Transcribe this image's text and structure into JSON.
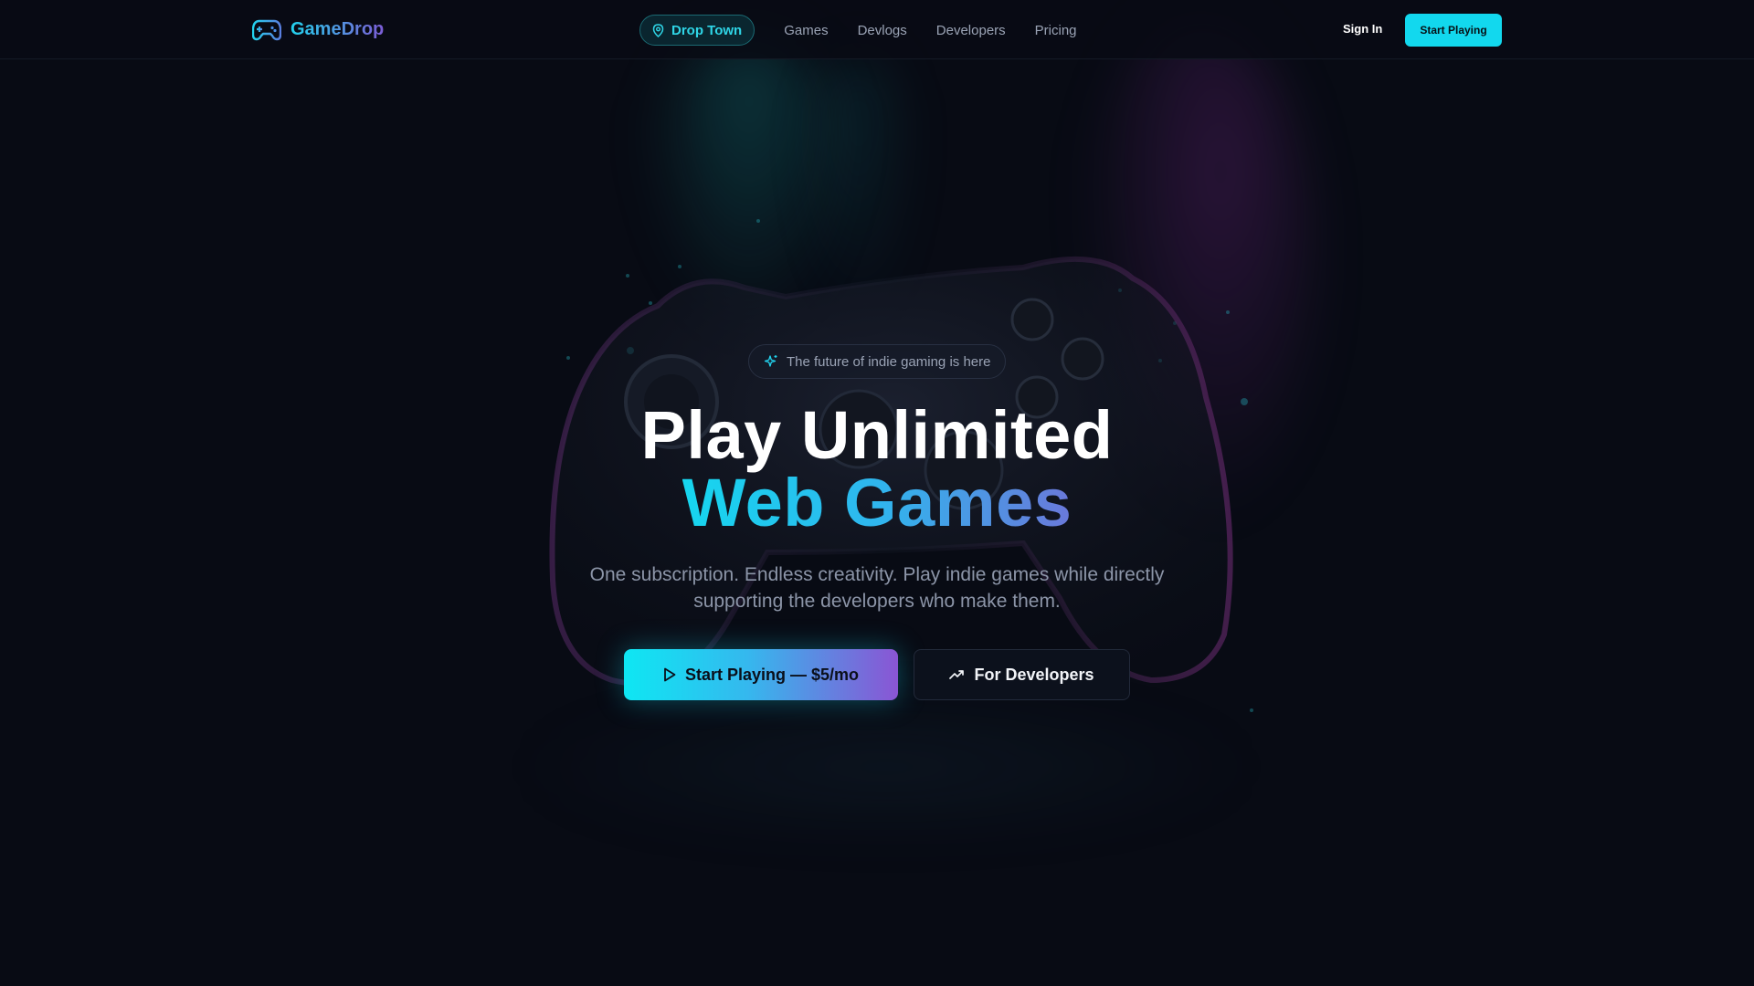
{
  "brand": {
    "name": "GameDrop",
    "icon": "gamepad-icon"
  },
  "nav": {
    "pill_label": "Drop Town",
    "pill_icon": "map-pin-icon",
    "links": [
      {
        "label": "Games"
      },
      {
        "label": "Devlogs"
      },
      {
        "label": "Developers"
      },
      {
        "label": "Pricing"
      }
    ],
    "sign_in": "Sign In",
    "cta": "Start Playing"
  },
  "hero": {
    "tagline": "The future of indie gaming is here",
    "tagline_icon": "sparkles-icon",
    "headline_line1": "Play Unlimited",
    "headline_line2": "Web Games",
    "subtitle": "One subscription. Endless creativity. Play indie games while directly supporting the developers who make them.",
    "primary_button": "Start Playing — $5/mo",
    "primary_icon": "play-icon",
    "secondary_button": "For Developers",
    "secondary_icon": "trending-up-icon"
  },
  "colors": {
    "background": "#080b14",
    "accent_cyan": "#12d8ee",
    "accent_purple": "#8a55d4",
    "muted_text": "#8c95a8"
  }
}
